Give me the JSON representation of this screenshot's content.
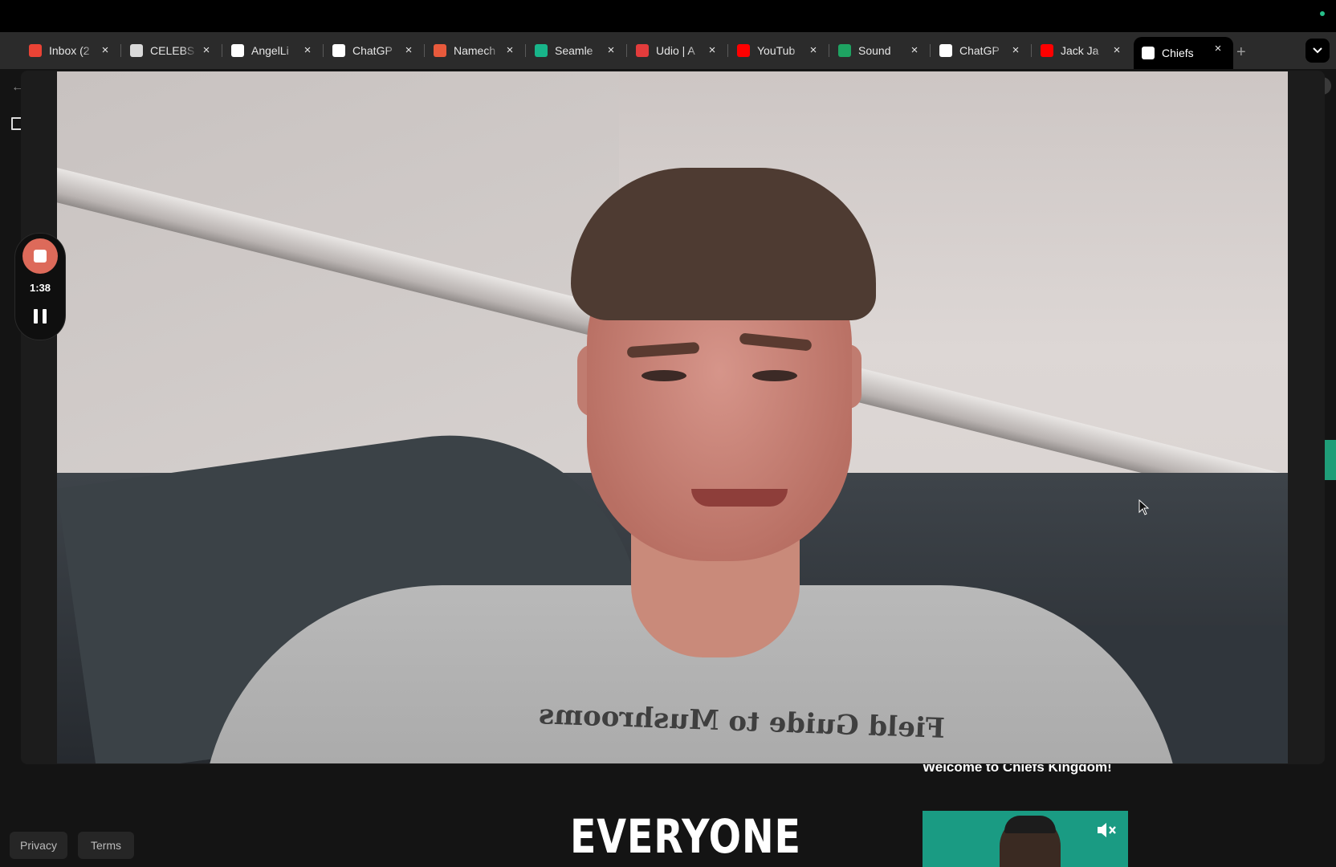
{
  "browser": {
    "tabs": [
      {
        "title": "Inbox (2",
        "favicon": "gmail-icon",
        "color": "#ea4335"
      },
      {
        "title": "CELEBS",
        "favicon": "celebs-icon",
        "color": "#d9d9d9"
      },
      {
        "title": "AngelLi",
        "favicon": "angellist-icon",
        "color": "#ffffff"
      },
      {
        "title": "ChatGP",
        "favicon": "openai-icon",
        "color": "#ffffff"
      },
      {
        "title": "Namech",
        "favicon": "namecheap-icon",
        "color": "#e85a3c"
      },
      {
        "title": "Seamle",
        "favicon": "seamless-icon",
        "color": "#18b58a"
      },
      {
        "title": "Udio | A",
        "favicon": "udio-icon",
        "color": "#e23c3c"
      },
      {
        "title": "YouTub",
        "favicon": "youtube-icon",
        "color": "#ff0000"
      },
      {
        "title": "Sound",
        "favicon": "sheets-icon",
        "color": "#1ea362"
      },
      {
        "title": "ChatGP",
        "favicon": "openai-icon",
        "color": "#ffffff"
      },
      {
        "title": "Jack Ja",
        "favicon": "youtube-icon",
        "color": "#ff0000"
      },
      {
        "title": "Chiefs",
        "favicon": "page-icon",
        "color": "#ffffff",
        "active": true
      }
    ],
    "new_tab_label": "+"
  },
  "recorder": {
    "elapsed": "1:38",
    "stop_color": "#dd6a5a"
  },
  "page": {
    "welcome_text": "Welcome to Chiefs Kingdom!",
    "headline": "EVERYONE",
    "footer": {
      "privacy": "Privacy",
      "terms": "Terms"
    },
    "accent_color": "#1f9d78"
  },
  "video": {
    "shirt_text": "Field Guide to Mushrooms"
  }
}
